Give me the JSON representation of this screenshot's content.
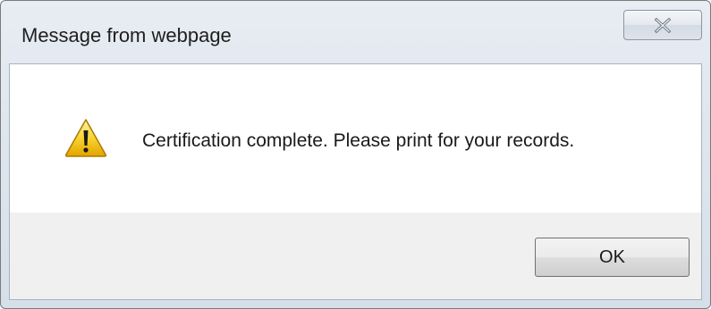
{
  "dialog": {
    "title": "Message from webpage",
    "close_icon": "close-icon",
    "warning_icon": "warning-icon",
    "message": "Certification complete.  Please print for your records.",
    "ok_label": "OK"
  }
}
